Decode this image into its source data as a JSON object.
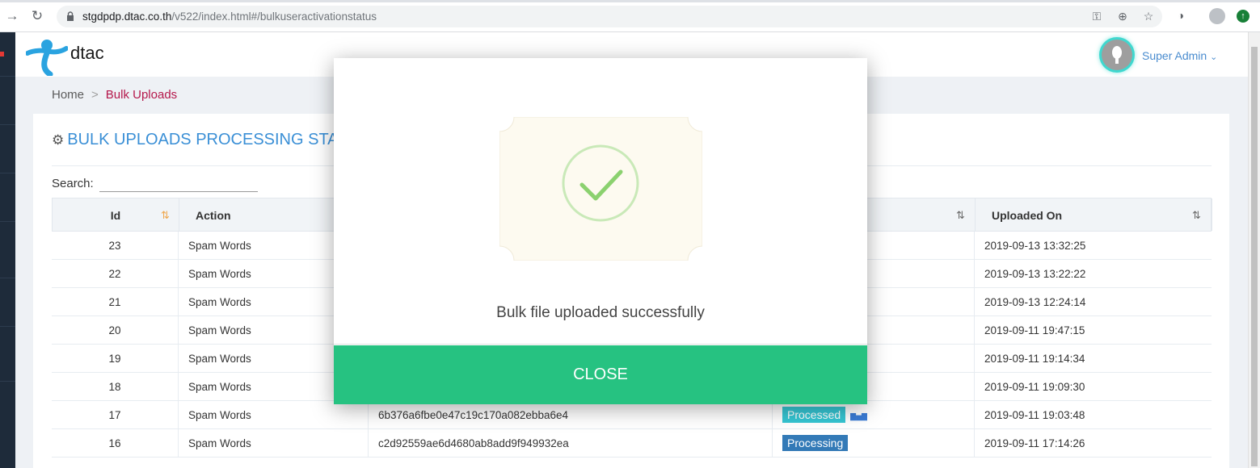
{
  "browser": {
    "url_host": "stgdpdp.dtac.co.th",
    "url_path": "/v522/index.html#/bulkuseractivationstatus"
  },
  "header": {
    "logo_text": "dtac",
    "user_name": "Super Admin"
  },
  "breadcrumb": {
    "home": "Home",
    "separator": ">",
    "current": "Bulk Uploads"
  },
  "page": {
    "title": "BULK UPLOADS PROCESSING STA",
    "search_label": "Search:"
  },
  "table": {
    "columns": [
      "Id",
      "Action",
      "Uploaded On"
    ],
    "rows": [
      {
        "id": "23",
        "action": "Spam Words",
        "file": "",
        "status": "",
        "uploaded": "2019-09-13 13:32:25"
      },
      {
        "id": "22",
        "action": "Spam Words",
        "file": "",
        "status": "",
        "uploaded": "2019-09-13 13:22:22"
      },
      {
        "id": "21",
        "action": "Spam Words",
        "file": "",
        "status": "",
        "uploaded": "2019-09-13 12:24:14"
      },
      {
        "id": "20",
        "action": "Spam Words",
        "file": "",
        "status": "",
        "uploaded": "2019-09-11 19:47:15"
      },
      {
        "id": "19",
        "action": "Spam Words",
        "file": "",
        "status": "",
        "uploaded": "2019-09-11 19:14:34"
      },
      {
        "id": "18",
        "action": "Spam Words",
        "file": "",
        "status": "",
        "uploaded": "2019-09-11 19:09:30"
      },
      {
        "id": "17",
        "action": "Spam Words",
        "file": "6b376a6fbe0e47c19c170a082ebba6e4",
        "status": "Processed",
        "uploaded": "2019-09-11 19:03:48"
      },
      {
        "id": "16",
        "action": "Spam Words",
        "file": "c2d92559ae6d4680ab8add9f949932ea",
        "status": "Processing",
        "uploaded": "2019-09-11 17:14:26"
      }
    ]
  },
  "modal": {
    "message": "Bulk file uploaded successfully",
    "close_label": "CLOSE"
  },
  "colors": {
    "accent": "#26c281",
    "title_blue": "#3a8fd6",
    "breadcrumb_active": "#b5174b",
    "badge_processed": "#36c6d3",
    "badge_processing": "#337ab7"
  }
}
